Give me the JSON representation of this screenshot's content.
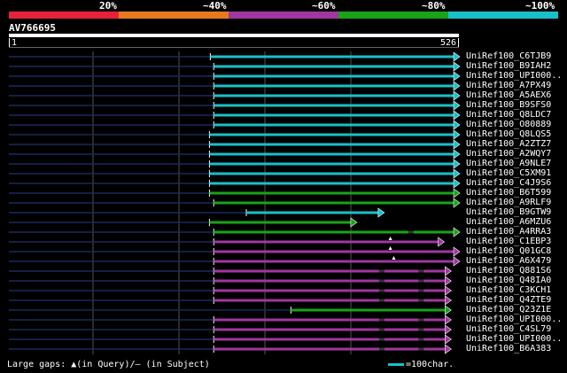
{
  "color_scale": {
    "labels": [
      "20%",
      "~40%",
      "~60%",
      "~80%",
      "~100%"
    ],
    "colors": [
      "#e8213a",
      "#e87a1d",
      "#a0379f",
      "#19a319",
      "#19c0c8"
    ]
  },
  "query": {
    "name": "AV766695",
    "start": "1",
    "end": "526",
    "length": 526
  },
  "hits": [
    {
      "name": "UniRef100_C6TJB9",
      "start": 236,
      "end": 526,
      "color": "#19c0c8",
      "gaps": []
    },
    {
      "name": "UniRef100_B9IAH2",
      "start": 240,
      "end": 526,
      "color": "#19c0c8",
      "gaps": []
    },
    {
      "name": "UniRef100_UPI000..",
      "start": 240,
      "end": 526,
      "color": "#19c0c8",
      "gaps": []
    },
    {
      "name": "UniRef100_A7PX49",
      "start": 240,
      "end": 526,
      "color": "#19c0c8",
      "gaps": []
    },
    {
      "name": "UniRef100_A5AEX6",
      "start": 240,
      "end": 526,
      "color": "#19c0c8",
      "gaps": []
    },
    {
      "name": "UniRef100_B9SFS0",
      "start": 240,
      "end": 526,
      "color": "#19c0c8",
      "gaps": []
    },
    {
      "name": "UniRef100_Q8LDC7",
      "start": 240,
      "end": 526,
      "color": "#19c0c8",
      "gaps": []
    },
    {
      "name": "UniRef100_O80889",
      "start": 240,
      "end": 526,
      "color": "#19c0c8",
      "gaps": []
    },
    {
      "name": "UniRef100_Q8LQS5",
      "start": 235,
      "end": 526,
      "color": "#19c0c8",
      "gaps": []
    },
    {
      "name": "UniRef100_A2ZTZ7",
      "start": 235,
      "end": 526,
      "color": "#19c0c8",
      "gaps": []
    },
    {
      "name": "UniRef100_A2WQY7",
      "start": 235,
      "end": 526,
      "color": "#19c0c8",
      "gaps": []
    },
    {
      "name": "UniRef100_A9NLE7",
      "start": 235,
      "end": 526,
      "color": "#19c0c8",
      "gaps": []
    },
    {
      "name": "UniRef100_C5XM91",
      "start": 235,
      "end": 526,
      "color": "#19c0c8",
      "gaps": []
    },
    {
      "name": "UniRef100_C4J9S6",
      "start": 235,
      "end": 526,
      "color": "#19c0c8",
      "gaps": []
    },
    {
      "name": "UniRef100_B6T599",
      "start": 235,
      "end": 526,
      "color": "#19a319",
      "gaps": []
    },
    {
      "name": "UniRef100_A9RLF9",
      "start": 240,
      "end": 526,
      "color": "#19a319",
      "gaps": []
    },
    {
      "name": "UniRef100_B9GTW9",
      "start": 278,
      "end": 438,
      "color": "#19c0c8",
      "gaps": []
    },
    {
      "name": "UniRef100_A6MZU6",
      "start": 235,
      "end": 406,
      "color": "#19a319",
      "gaps": []
    },
    {
      "name": "UniRef100_A4RRA3",
      "start": 240,
      "end": 526,
      "color": "#19a319",
      "gaps": [
        470
      ]
    },
    {
      "name": "UniRef100_C1EBP3",
      "start": 240,
      "end": 508,
      "color": "#a0379f",
      "gaps": [],
      "query_gap": 446
    },
    {
      "name": "UniRef100_Q01GC8",
      "start": 240,
      "end": 526,
      "color": "#a0379f",
      "gaps": [],
      "query_gap": 446
    },
    {
      "name": "UniRef100_A6X479",
      "start": 240,
      "end": 526,
      "color": "#a0379f",
      "gaps": [],
      "query_gap": 450
    },
    {
      "name": "UniRef100_Q881S6",
      "start": 240,
      "end": 516,
      "color": "#a0379f",
      "gaps": [
        436,
        482
      ]
    },
    {
      "name": "UniRef100_Q48IA0",
      "start": 240,
      "end": 516,
      "color": "#a0379f",
      "gaps": [
        436,
        482
      ]
    },
    {
      "name": "UniRef100_C3KCH1",
      "start": 240,
      "end": 516,
      "color": "#a0379f",
      "gaps": [
        436,
        482
      ]
    },
    {
      "name": "UniRef100_Q4ZTE9",
      "start": 240,
      "end": 516,
      "color": "#a0379f",
      "gaps": [
        436,
        482
      ]
    },
    {
      "name": "UniRef100_Q23Z1E",
      "start": 330,
      "end": 516,
      "color": "#19a319",
      "gaps": []
    },
    {
      "name": "UniRef100_UPI000..",
      "start": 240,
      "end": 516,
      "color": "#a0379f",
      "gaps": [
        436,
        482
      ]
    },
    {
      "name": "UniRef100_C4SL79",
      "start": 240,
      "end": 516,
      "color": "#a0379f",
      "gaps": [
        436,
        482
      ]
    },
    {
      "name": "UniRef100_UPI000..",
      "start": 240,
      "end": 516,
      "color": "#a0379f",
      "gaps": [
        436,
        482
      ]
    },
    {
      "name": "UniRef100_B6A383",
      "start": 240,
      "end": 516,
      "color": "#a0379f",
      "gaps": [
        436,
        482
      ]
    }
  ],
  "footer": {
    "gaps_text": "Large gaps: ▲(in Query)/– (in Subject)",
    "legend_text": "=100char."
  }
}
